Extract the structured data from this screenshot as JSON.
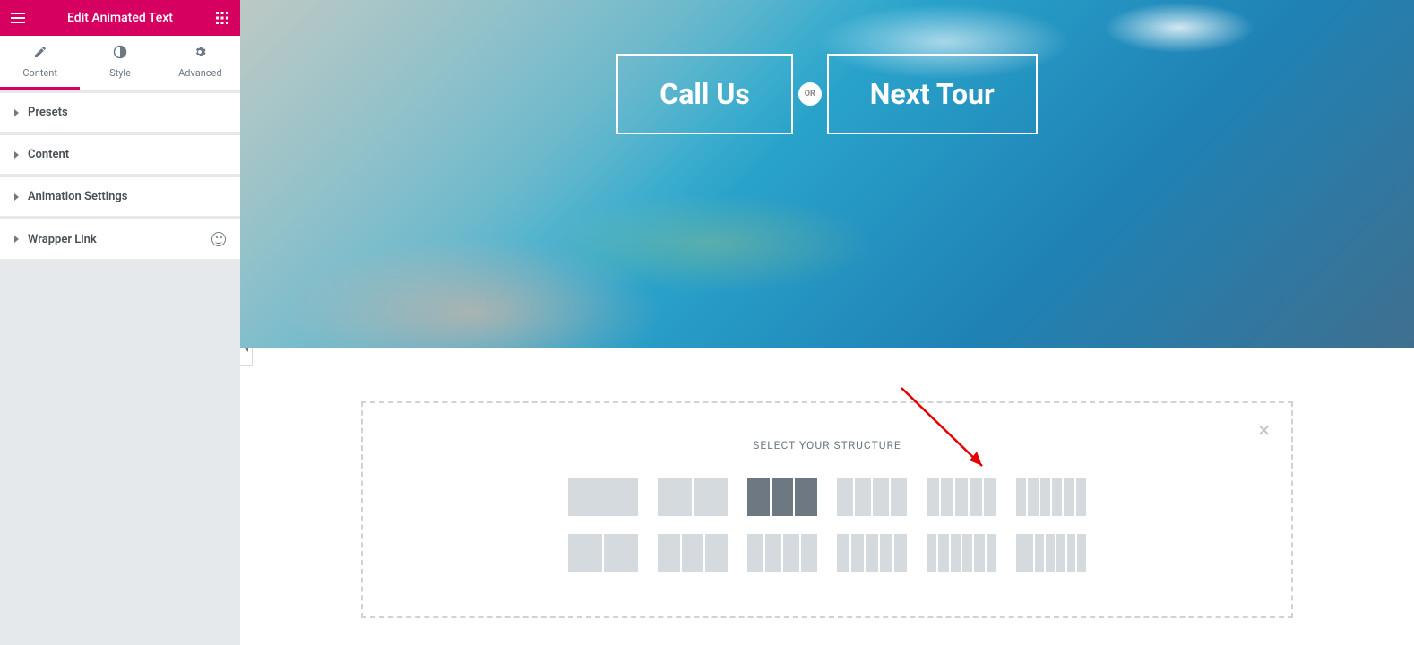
{
  "header": {
    "title": "Edit Animated Text"
  },
  "tabs": {
    "content": "Content",
    "style": "Style",
    "advanced": "Advanced"
  },
  "panels": {
    "presets": "Presets",
    "content": "Content",
    "animation": "Animation Settings",
    "wrapper": "Wrapper Link"
  },
  "hero": {
    "btn1": "Call Us",
    "sep": "OR",
    "btn2": "Next Tour"
  },
  "picker": {
    "title": "SELECT YOUR STRUCTURE"
  }
}
